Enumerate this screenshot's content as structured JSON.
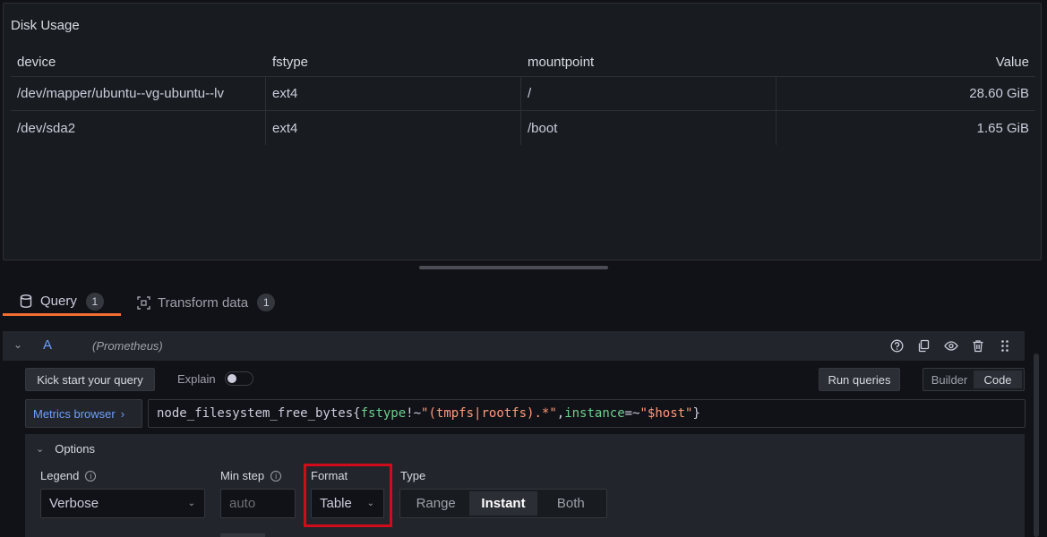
{
  "panel": {
    "title": "Disk Usage",
    "columns": [
      "device",
      "fstype",
      "mountpoint",
      "Value"
    ],
    "rows": [
      {
        "device": "/dev/mapper/ubuntu--vg-ubuntu--lv",
        "fstype": "ext4",
        "mountpoint": "/",
        "value": "28.60 GiB"
      },
      {
        "device": "/dev/sda2",
        "fstype": "ext4",
        "mountpoint": "/boot",
        "value": "1.65 GiB"
      }
    ]
  },
  "tabs": [
    {
      "label": "Query",
      "count": "1",
      "icon": "database-icon",
      "active": true
    },
    {
      "label": "Transform data",
      "count": "1",
      "icon": "transform-icon",
      "active": false
    }
  ],
  "query": {
    "ref_id": "A",
    "datasource": "(Prometheus)",
    "kick_start_label": "Kick start your query",
    "explain_label": "Explain",
    "run_queries_label": "Run queries",
    "mode_builder": "Builder",
    "mode_code": "Code",
    "metrics_browser_label": "Metrics browser",
    "expr": {
      "metric": "node_filesystem_free_bytes",
      "open": "{",
      "label1": "fstype",
      "op1": "!~",
      "val1": "\"(tmpfs|rootfs).*\"",
      "comma": ",",
      "label2": "instance",
      "op2": "=~",
      "val2": "\"$host\"",
      "close": "}"
    }
  },
  "options": {
    "header": "Options",
    "legend_label": "Legend",
    "legend_value": "Verbose",
    "min_step_label": "Min step",
    "min_step_placeholder": "auto",
    "format_label": "Format",
    "format_value": "Table",
    "type_label": "Type",
    "type_options": [
      "Range",
      "Instant",
      "Both"
    ],
    "type_selected": "Instant"
  },
  "colors": {
    "accent_orange": "#f26d31",
    "link_blue": "#6e9fff",
    "highlight_red": "#d10c1a"
  }
}
